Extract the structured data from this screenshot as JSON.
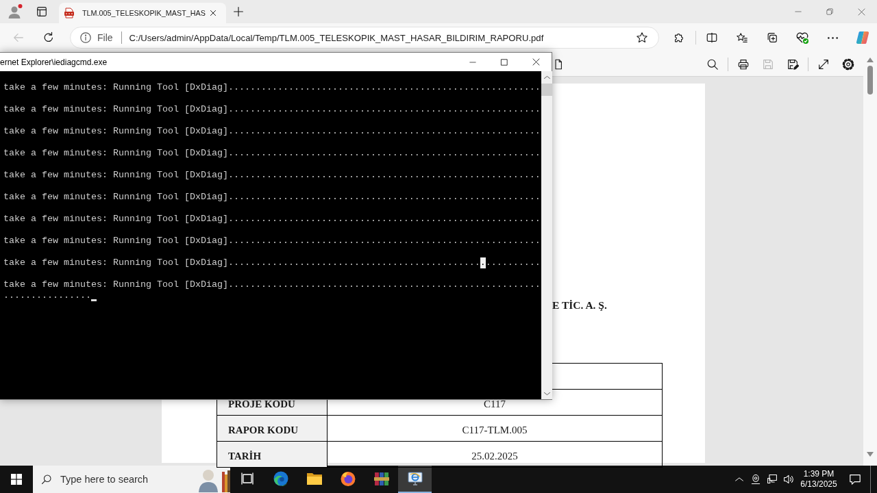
{
  "browser": {
    "tabs": [
      {
        "title": "TLM.005_TELESKOPIK_MAST_HAS",
        "selected": true
      }
    ],
    "back_button": {
      "disabled": true
    },
    "address": {
      "scheme_label": "File",
      "url": "C:/Users/admin/AppData/Local/Temp/TLM.005_TELESKOPIK_MAST_HASAR_BILDIRIM_RAPORU.pdf"
    }
  },
  "pdf_toolbar": {
    "save_button": {
      "disabled": true
    }
  },
  "pdf_page": {
    "heading": "E TİC. A. Ş.",
    "table": {
      "rows": [
        {
          "label": "PROJE KODU",
          "value": "C117"
        },
        {
          "label": "RAPOR KODU",
          "value": "C117-TLM.005"
        },
        {
          "label": "TARİH",
          "value": "25.02.2025"
        }
      ]
    }
  },
  "console_window": {
    "title": "ernet Explorer\\iediagcmd.exe",
    "lines": [
      {
        "text": "take a few minutes: Running Tool [DxDiag]........................................................."
      },
      {
        "text": "take a few minutes: Running Tool [DxDiag]........................................................."
      },
      {
        "text": "take a few minutes: Running Tool [DxDiag]........................................................."
      },
      {
        "text": "take a few minutes: Running Tool [DxDiag]........................................................."
      },
      {
        "text": "take a few minutes: Running Tool [DxDiag]........................................................."
      },
      {
        "text": "take a few minutes: Running Tool [DxDiag]........................................................."
      },
      {
        "text": "take a few minutes: Running Tool [DxDiag]........................................................."
      },
      {
        "text": "take a few minutes: Running Tool [DxDiag]........................................................."
      },
      {
        "text": "take a few minutes: Running Tool [DxDiag]..............................................",
        "selected_text": ".",
        "text_after": ".........."
      },
      {
        "text": "take a few minutes: Running Tool [DxDiag]........................................................."
      }
    ],
    "continuation": {
      "text": "................",
      "cursor": true
    }
  },
  "taskbar": {
    "search": {
      "placeholder": "Type here to search"
    },
    "apps": [
      {
        "kind": "swirl",
        "selected": false
      },
      {
        "kind": "folder",
        "selected": false
      },
      {
        "kind": "flame",
        "selected": false
      },
      {
        "kind": "books",
        "selected": false
      },
      {
        "kind": "monitor",
        "selected": true
      }
    ],
    "clock": {
      "time": "1:39 PM",
      "date": "6/13/2025"
    }
  }
}
